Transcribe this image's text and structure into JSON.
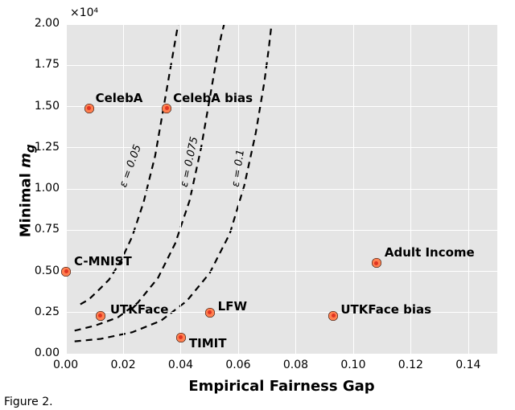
{
  "chart_data": {
    "type": "scatter",
    "title": "",
    "xlabel": "Empirical Fairness Gap",
    "ylabel": "Minimal m_g",
    "xlim": [
      0.0,
      0.15
    ],
    "ylim": [
      0.0,
      2.0
    ],
    "y_scale_factor": 10000,
    "y_exp_label": "×10⁴",
    "xticks": [
      0.0,
      0.02,
      0.04,
      0.06,
      0.08,
      0.1,
      0.12,
      0.14
    ],
    "yticks": [
      0.0,
      0.25,
      0.5,
      0.75,
      1.0,
      1.25,
      1.5,
      1.75,
      2.0
    ],
    "series": [
      {
        "name": "datasets",
        "points": [
          {
            "label": "CelebA",
            "x": 0.008,
            "y": 1.49,
            "label_dx": 8,
            "label_dy": -22
          },
          {
            "label": "CelebA bias",
            "x": 0.035,
            "y": 1.49,
            "label_dx": 8,
            "label_dy": -22
          },
          {
            "label": "C-MNIST",
            "x": 0.0,
            "y": 0.5,
            "label_dx": 10,
            "label_dy": -22
          },
          {
            "label": "UTKFace",
            "x": 0.012,
            "y": 0.23,
            "label_dx": 12,
            "label_dy": -17
          },
          {
            "label": "LFW",
            "x": 0.05,
            "y": 0.25,
            "label_dx": 10,
            "label_dy": -17
          },
          {
            "label": "TIMIT",
            "x": 0.04,
            "y": 0.1,
            "label_dx": 10,
            "label_dy": -2
          },
          {
            "label": "UTKFace bias",
            "x": 0.093,
            "y": 0.23,
            "label_dx": 9,
            "label_dy": -17
          },
          {
            "label": "Adult Income",
            "x": 0.108,
            "y": 0.55,
            "label_dx": 10,
            "label_dy": -22
          }
        ]
      }
    ],
    "curves": [
      {
        "label": "ε = 0.05",
        "xs": [
          0.005,
          0.008,
          0.011,
          0.015,
          0.019,
          0.023,
          0.027,
          0.031,
          0.034,
          0.036,
          0.0375,
          0.0385,
          0.039
        ],
        "ys": [
          0.3,
          0.33,
          0.38,
          0.45,
          0.56,
          0.71,
          0.92,
          1.2,
          1.5,
          1.7,
          1.85,
          1.95,
          2.0
        ],
        "lx": 0.02,
        "ly": 1.05,
        "lr": -70
      },
      {
        "label": "ε = 0.075",
        "xs": [
          0.003,
          0.01,
          0.018,
          0.025,
          0.032,
          0.038,
          0.043,
          0.047,
          0.05,
          0.0525,
          0.054,
          0.055
        ],
        "ys": [
          0.14,
          0.17,
          0.22,
          0.31,
          0.46,
          0.67,
          0.93,
          1.25,
          1.55,
          1.8,
          1.93,
          2.0
        ],
        "lx": 0.041,
        "ly": 1.05,
        "lr": -78
      },
      {
        "label": "ε = 0.1",
        "xs": [
          0.003,
          0.012,
          0.023,
          0.033,
          0.042,
          0.05,
          0.057,
          0.062,
          0.066,
          0.069,
          0.0705,
          0.0715
        ],
        "ys": [
          0.075,
          0.09,
          0.13,
          0.2,
          0.32,
          0.49,
          0.73,
          1.02,
          1.34,
          1.65,
          1.85,
          2.0
        ],
        "lx": 0.059,
        "ly": 1.05,
        "lr": -82
      }
    ]
  },
  "xtick_labels": [
    "0.00",
    "0.02",
    "0.04",
    "0.06",
    "0.08",
    "0.10",
    "0.12",
    "0.14"
  ],
  "ytick_labels": [
    "0.00",
    "0.25",
    "0.50",
    "0.75",
    "1.00",
    "1.25",
    "1.50",
    "1.75",
    "2.00"
  ],
  "caption_prefix": "Figure 2."
}
